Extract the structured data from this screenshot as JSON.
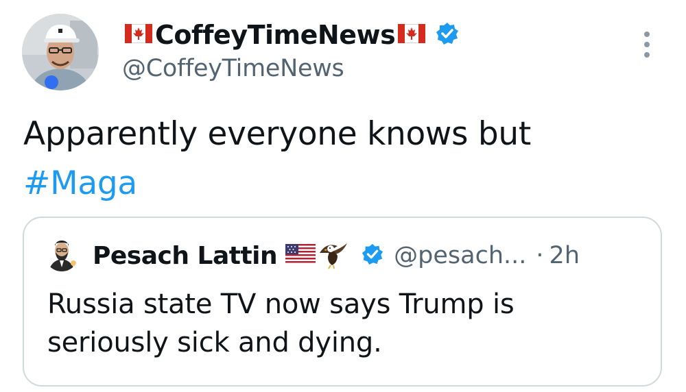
{
  "tweet": {
    "author": {
      "display_name": "CoffeyTimeNews",
      "handle": "@CoffeyTimeNews",
      "flag_icon": "canada-flag-icon",
      "verified_icon": "verified-badge-icon"
    },
    "more_icon": "more-options-icon",
    "text": "Apparently everyone knows but",
    "hashtag": "#Maga"
  },
  "quote": {
    "author": {
      "display_name": "Pesach Lattin",
      "handle": "@pesach...",
      "flag_icon": "us-flag-icon",
      "eagle_icon": "eagle-icon",
      "verified_icon": "verified-badge-icon"
    },
    "separator": "·",
    "time": "2h",
    "text": "Russia state TV now says Trump is seriously sick and dying."
  },
  "colors": {
    "text_primary": "#0f1419",
    "text_secondary": "#536471",
    "accent": "#1d9bf0",
    "canada_red": "#d52b1e",
    "border": "#cfd9de"
  }
}
